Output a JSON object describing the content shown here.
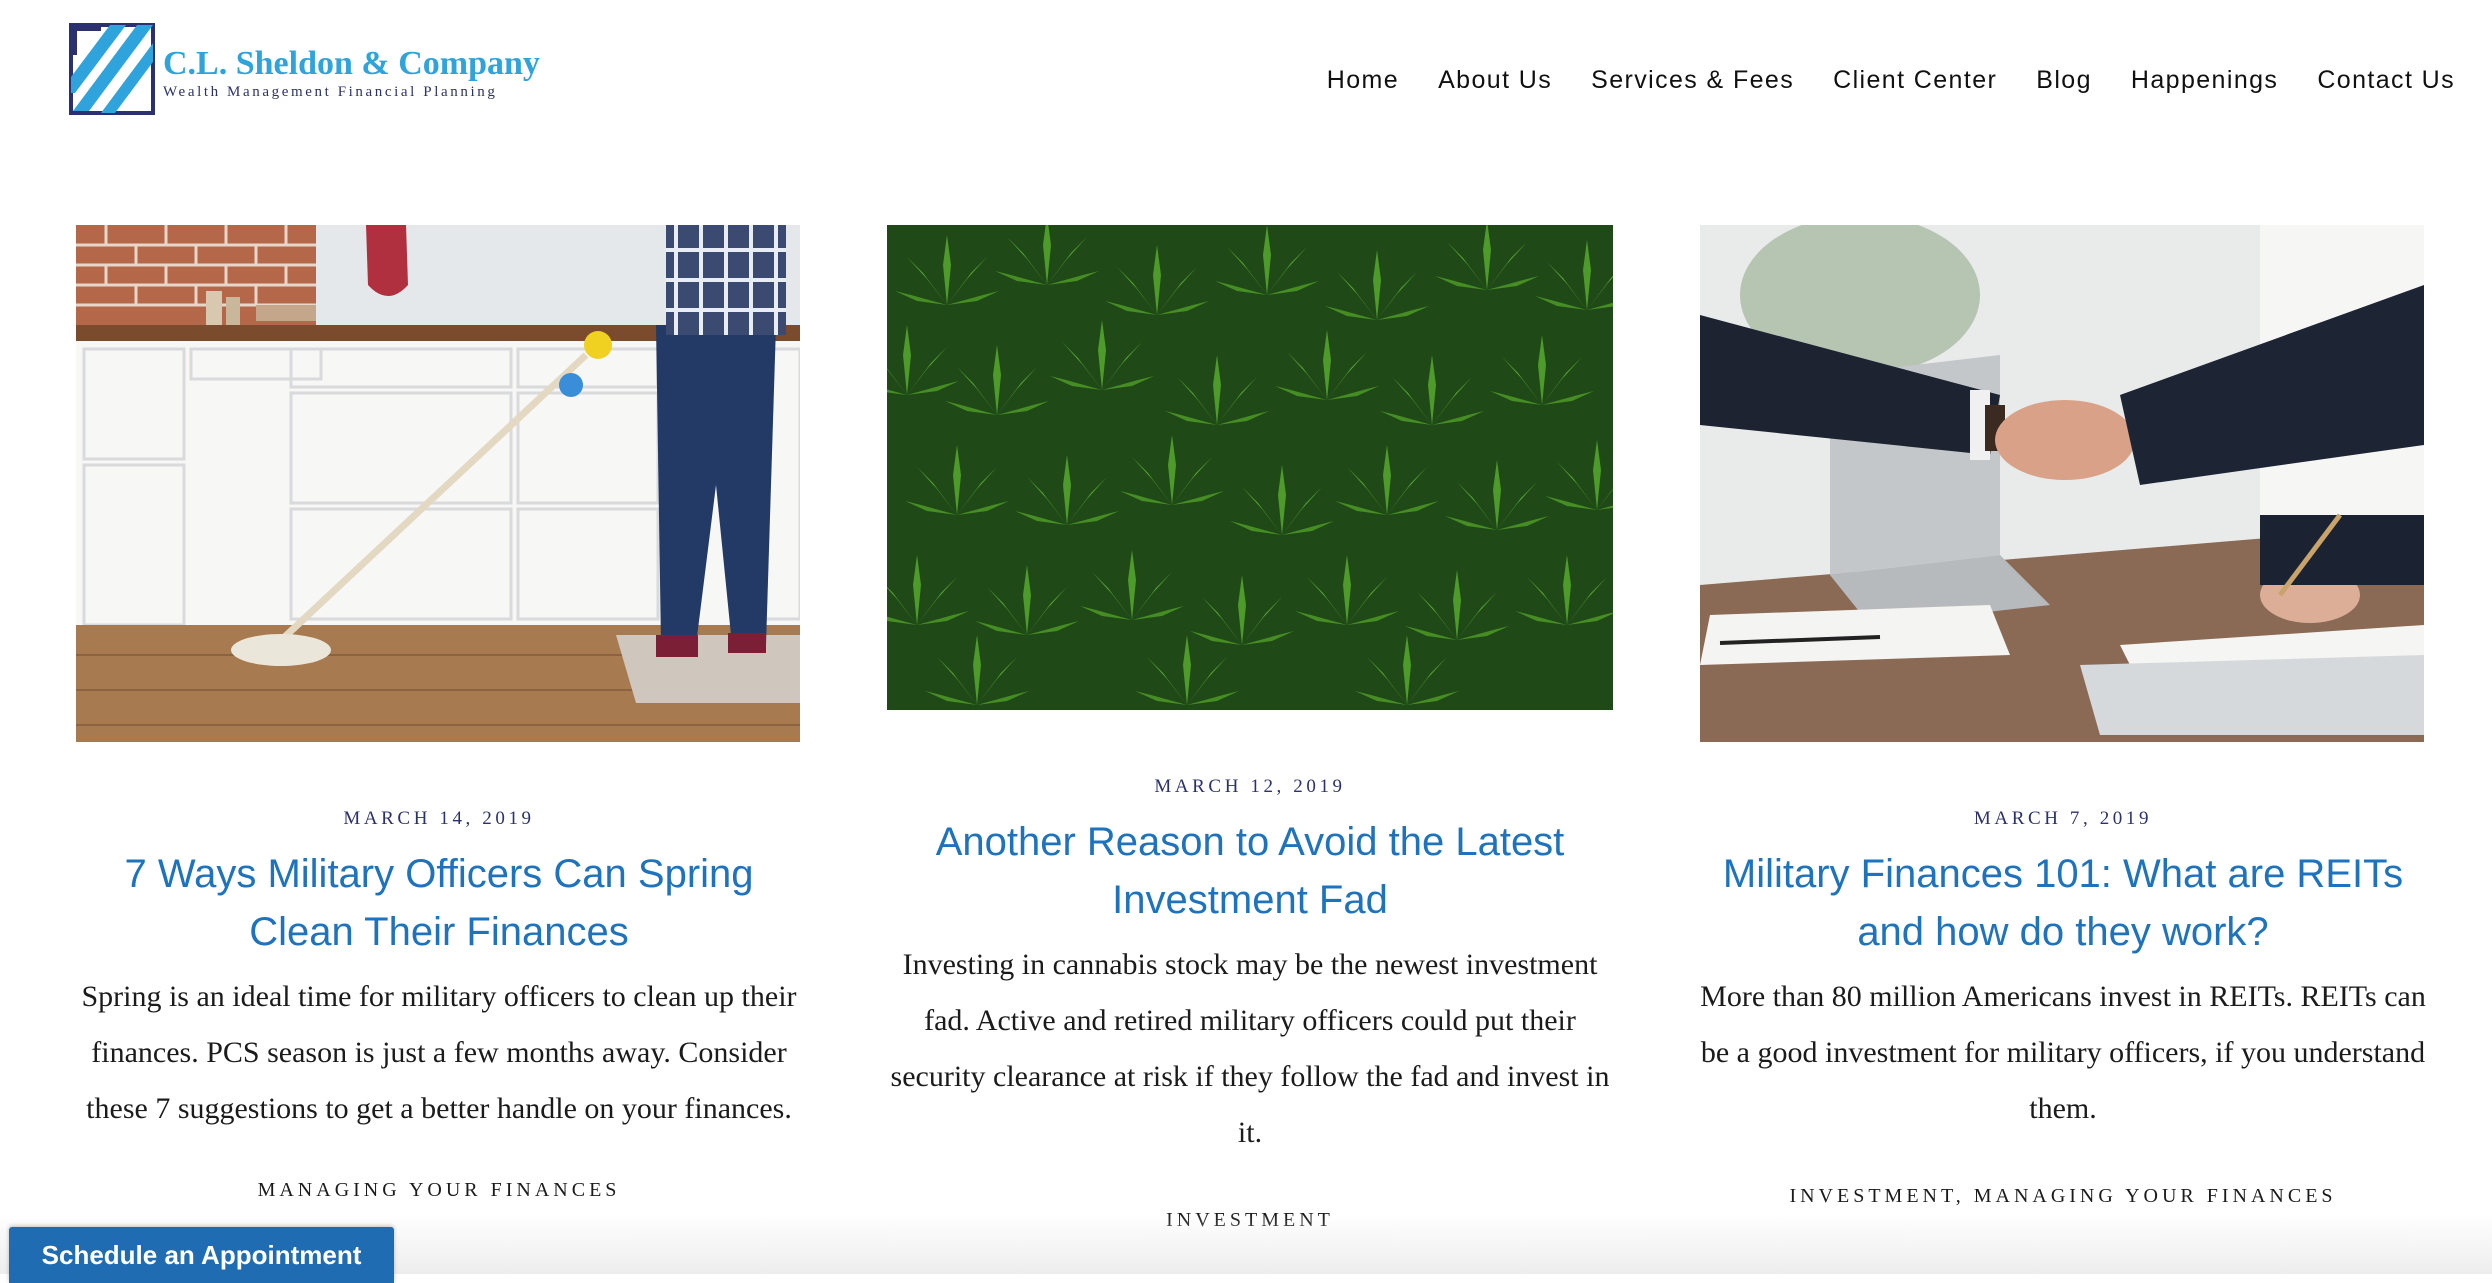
{
  "brand": {
    "name": "C.L. Sheldon & Company",
    "tagline": "Wealth Management Financial Planning",
    "colors": {
      "primary_blue": "#2fa3dc",
      "navy": "#2b3170",
      "link_blue": "#1e73be"
    }
  },
  "nav": {
    "items": [
      {
        "label": "Home"
      },
      {
        "label": "About Us"
      },
      {
        "label": "Services & Fees"
      },
      {
        "label": "Client Center"
      },
      {
        "label": "Blog"
      },
      {
        "label": "Happenings"
      },
      {
        "label": "Contact Us"
      }
    ]
  },
  "posts": [
    {
      "image": "woman-mopping-kitchen-floor",
      "date": "MARCH 14, 2019",
      "title": "7 Ways Military Officers Can Spring Clean Their Finances",
      "excerpt": "Spring is an ideal time for military officers to clean up their finances. PCS season is just a few months away. Consider these 7 suggestions to get a better handle on your finances.",
      "categories": "MANAGING YOUR FINANCES"
    },
    {
      "image": "cannabis-plants",
      "date": "MARCH 12, 2019",
      "title": "Another Reason to Avoid the Latest Investment Fad",
      "excerpt": "Investing in cannabis stock may be the newest investment fad. Active and retired military officers could put their security clearance at risk if they follow the fad and invest in it.",
      "categories": "INVESTMENT"
    },
    {
      "image": "business-handshake-over-desk",
      "date": "MARCH 7, 2019",
      "title": "Military Finances 101: What are REITs and how do they work?",
      "excerpt": "More than 80 million Americans invest in REITs. REITs can be a good investment for military officers, if you understand them.",
      "categories": "INVESTMENT, MANAGING YOUR FINANCES"
    }
  ],
  "cta": {
    "schedule_label": "Schedule an Appointment",
    "color": "#1f6cb3"
  }
}
